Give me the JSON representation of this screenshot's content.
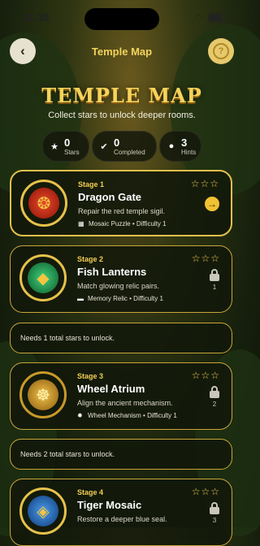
{
  "status_bar": {
    "time": "11:30"
  },
  "nav": {
    "title": "Temple Map",
    "help_label": "?"
  },
  "hero": {
    "title": "TEMPLE MAP",
    "subtitle": "Collect stars to unlock deeper rooms."
  },
  "stats": [
    {
      "value": "0",
      "label": "Stars",
      "icon": "star-icon"
    },
    {
      "value": "0",
      "label": "Completed",
      "icon": "check-badge-icon"
    },
    {
      "value": "3",
      "label": "Hints",
      "icon": "bulb-icon"
    }
  ],
  "stages": [
    {
      "stage": "Stage 1",
      "name": "Dragon Gate",
      "desc": "Repair the red temple sigil.",
      "type": "Mosaic Puzzle",
      "difficulty": "Difficulty 1",
      "stars": "☆☆☆",
      "locked": false
    },
    {
      "stage": "Stage 2",
      "name": "Fish Lanterns",
      "desc": "Match glowing relic pairs.",
      "type": "Memory Relic",
      "difficulty": "Difficulty 1",
      "stars": "☆☆☆",
      "locked": true,
      "lock_count": "1"
    },
    {
      "stage": "Stage 3",
      "name": "Wheel Atrium",
      "desc": "Align the ancient mechanism.",
      "type": "Wheel Mechanism",
      "difficulty": "Difficulty 1",
      "stars": "☆☆☆",
      "locked": true,
      "lock_count": "2"
    },
    {
      "stage": "Stage 4",
      "name": "Tiger Mosaic",
      "desc": "Restore a deeper blue seal.",
      "stars": "☆☆☆",
      "locked": true,
      "lock_count": "3"
    }
  ],
  "notices": [
    "Needs 1 total stars to unlock.",
    "Needs 2 total stars to unlock."
  ],
  "colors": {
    "accent_gold": "#f3cf52",
    "card_border": "#c9a53a",
    "background": "#16200d"
  }
}
